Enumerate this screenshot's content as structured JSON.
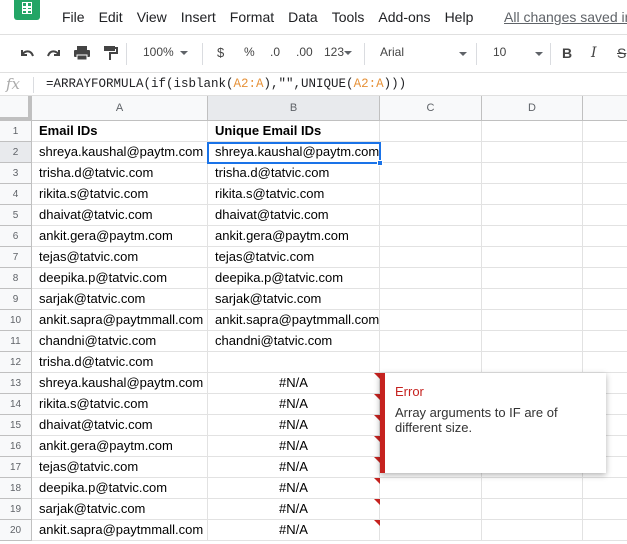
{
  "menubar": {
    "items": [
      "File",
      "Edit",
      "View",
      "Insert",
      "Format",
      "Data",
      "Tools",
      "Add-ons",
      "Help"
    ],
    "save_status": "All changes saved in Drive"
  },
  "toolbar": {
    "zoom": "100%",
    "currency": "$",
    "percent": "%",
    "decrease_decimal": ".0",
    "increase_decimal": ".00",
    "more_formats": "123",
    "font": "Arial",
    "font_size": "10",
    "bold": "B",
    "italic": "I",
    "strikethrough": "S"
  },
  "formula_bar": {
    "fx_label": "fx",
    "formula_parts": [
      "=ARRAYFORMULA(if(isblank(",
      "A2:A",
      "),\"\",UNIQUE(",
      "A2:A",
      ")))"
    ]
  },
  "columns": [
    "A",
    "B",
    "C",
    "D"
  ],
  "rows": [
    {
      "num": "1",
      "a": "Email IDs",
      "b": "Unique Email IDs",
      "err": false
    },
    {
      "num": "2",
      "a": "shreya.kaushal@paytm.com",
      "b": "shreya.kaushal@paytm.com",
      "err": false
    },
    {
      "num": "3",
      "a": "trisha.d@tatvic.com",
      "b": "trisha.d@tatvic.com",
      "err": false
    },
    {
      "num": "4",
      "a": "rikita.s@tatvic.com",
      "b": "rikita.s@tatvic.com",
      "err": false
    },
    {
      "num": "5",
      "a": "dhaivat@tatvic.com",
      "b": "dhaivat@tatvic.com",
      "err": false
    },
    {
      "num": "6",
      "a": "ankit.gera@paytm.com",
      "b": "ankit.gera@paytm.com",
      "err": false
    },
    {
      "num": "7",
      "a": "tejas@tatvic.com",
      "b": "tejas@tatvic.com",
      "err": false
    },
    {
      "num": "8",
      "a": "deepika.p@tatvic.com",
      "b": "deepika.p@tatvic.com",
      "err": false
    },
    {
      "num": "9",
      "a": "sarjak@tatvic.com",
      "b": "sarjak@tatvic.com",
      "err": false
    },
    {
      "num": "10",
      "a": "ankit.sapra@paytmmall.com",
      "b": "ankit.sapra@paytmmall.com",
      "err": false
    },
    {
      "num": "11",
      "a": "chandni@tatvic.com",
      "b": "chandni@tatvic.com",
      "err": false
    },
    {
      "num": "12",
      "a": "trisha.d@tatvic.com",
      "b": "",
      "err": false
    },
    {
      "num": "13",
      "a": "shreya.kaushal@paytm.com",
      "b": "#N/A",
      "err": true
    },
    {
      "num": "14",
      "a": "rikita.s@tatvic.com",
      "b": "#N/A",
      "err": true
    },
    {
      "num": "15",
      "a": "dhaivat@tatvic.com",
      "b": "#N/A",
      "err": true
    },
    {
      "num": "16",
      "a": "ankit.gera@paytm.com",
      "b": "#N/A",
      "err": true
    },
    {
      "num": "17",
      "a": "tejas@tatvic.com",
      "b": "#N/A",
      "err": true
    },
    {
      "num": "18",
      "a": "deepika.p@tatvic.com",
      "b": "#N/A",
      "err": true
    },
    {
      "num": "19",
      "a": "sarjak@tatvic.com",
      "b": "#N/A",
      "err": true
    },
    {
      "num": "20",
      "a": "ankit.sapra@paytmmall.com",
      "b": "#N/A",
      "err": true
    }
  ],
  "selected_cell": "B2",
  "error_tooltip": {
    "title": "Error",
    "message": "Array arguments to IF are of different size."
  }
}
